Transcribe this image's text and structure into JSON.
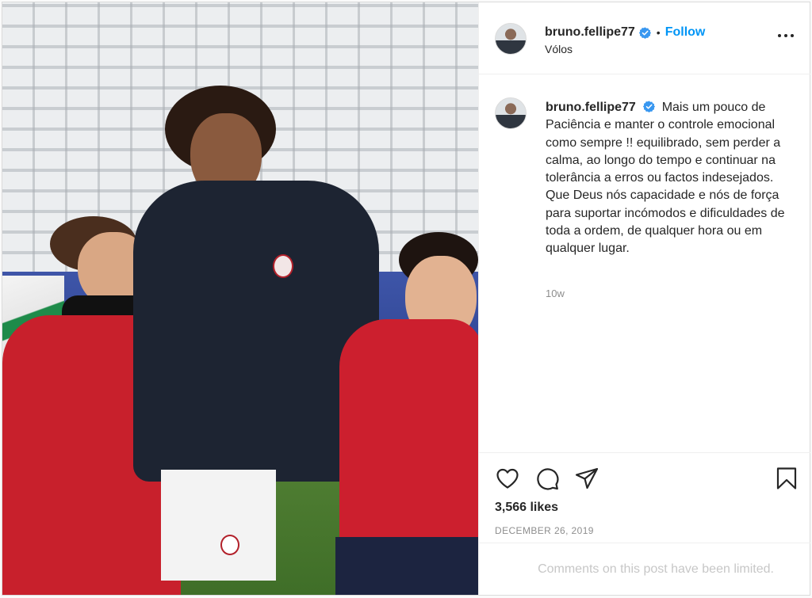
{
  "post": {
    "username": "bruno.fellipe77",
    "follow_label": "Follow",
    "dot": "•",
    "location": "Vólos",
    "caption_text": "Mais um pouco de Paciência e manter o controle emocional como sempre !! equilibrado, sem perder a calma, ao longo do tempo e continuar na tolerância a erros ou factos indesejados. Que Deus nós capacidade e nós de força para suportar incómodos e dificuldades de toda a ordem, de qualquer hora ou em qualquer lugar.",
    "age": "10w",
    "likes": "3,566 likes",
    "date": "DECEMBER 26, 2019",
    "comments_limited": "Comments on this post have been limited."
  },
  "icons": {
    "verified": "verified-badge-icon",
    "more": "more-options-icon",
    "like": "heart-icon",
    "comment": "comment-icon",
    "share": "share-icon",
    "save": "bookmark-icon"
  },
  "colors": {
    "accent": "#0095f6",
    "secondary_text": "#8e8e8e",
    "border": "#dbdbdb"
  }
}
